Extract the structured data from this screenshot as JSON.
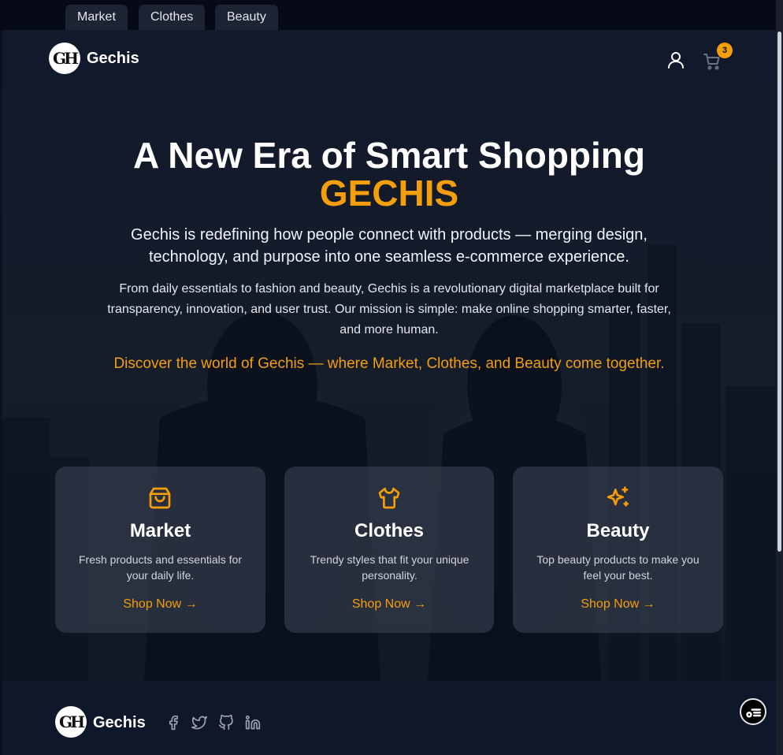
{
  "tabs": [
    {
      "label": "Market"
    },
    {
      "label": "Clothes"
    },
    {
      "label": "Beauty"
    }
  ],
  "header": {
    "logo_text": "GH",
    "brand": "Gechis",
    "cart_count": "3",
    "icons": [
      "user-icon",
      "cart-icon"
    ]
  },
  "hero": {
    "title": "A New Era of Smart Shopping",
    "brand": "GECHIS",
    "lead": "Gechis is redefining how people connect with products — merging design, technology, and purpose into one seamless e-commerce experience.",
    "body": "From daily essentials to fashion and beauty, Gechis is a revolutionary digital marketplace built for transparency, innovation, and user trust. Our mission is simple: make online shopping smarter, faster, and more human.",
    "cta": "Discover the world of Gechis — where Market, Clothes, and Beauty come together."
  },
  "cards": [
    {
      "icon": "shopping-bag-icon",
      "title": "Market",
      "desc": "Fresh products and essentials for your daily life.",
      "link": "Shop Now →"
    },
    {
      "icon": "shirt-icon",
      "title": "Clothes",
      "desc": "Trendy styles that fit your unique personality.",
      "link": "Shop Now →"
    },
    {
      "icon": "sparkles-icon",
      "title": "Beauty",
      "desc": "Top beauty products to make you feel your best.",
      "link": "Shop Now →"
    }
  ],
  "footer": {
    "logo_text": "GH",
    "brand": "Gechis",
    "social": [
      "facebook-icon",
      "twitter-icon",
      "github-icon",
      "linkedin-icon"
    ]
  },
  "colors": {
    "accent": "#f59e0b",
    "background": "#0f172a",
    "card": "#333a4a"
  }
}
